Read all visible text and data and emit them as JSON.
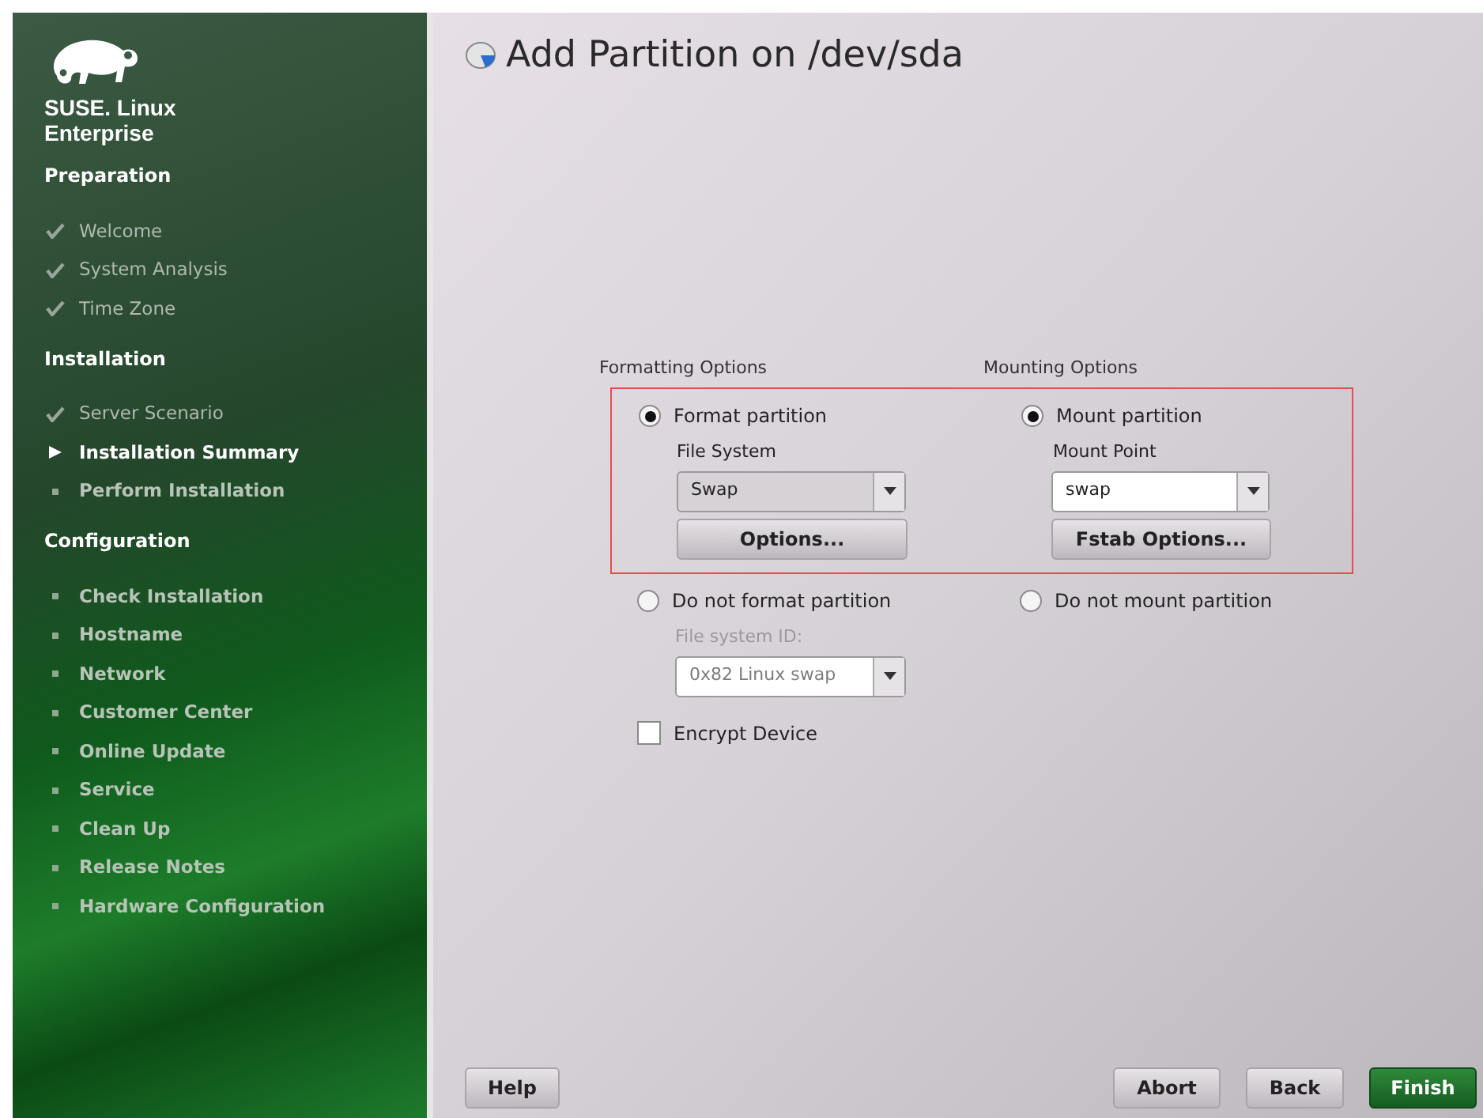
{
  "brand": {
    "line1": "SUSE. Linux",
    "line2": "Enterprise"
  },
  "sidebar": {
    "sections": [
      {
        "title": "Preparation",
        "items": [
          {
            "label": "Welcome",
            "kind": "done"
          },
          {
            "label": "System Analysis",
            "kind": "done"
          },
          {
            "label": "Time Zone",
            "kind": "done"
          }
        ]
      },
      {
        "title": "Installation",
        "items": [
          {
            "label": "Server Scenario",
            "kind": "done"
          },
          {
            "label": "Installation Summary",
            "kind": "current"
          },
          {
            "label": "Perform Installation",
            "kind": "pending"
          }
        ]
      },
      {
        "title": "Configuration",
        "items": [
          {
            "label": "Check Installation",
            "kind": "pending"
          },
          {
            "label": "Hostname",
            "kind": "pending"
          },
          {
            "label": "Network",
            "kind": "pending"
          },
          {
            "label": "Customer Center",
            "kind": "pending"
          },
          {
            "label": "Online Update",
            "kind": "pending"
          },
          {
            "label": "Service",
            "kind": "pending"
          },
          {
            "label": "Clean Up",
            "kind": "pending"
          },
          {
            "label": "Release Notes",
            "kind": "pending"
          },
          {
            "label": "Hardware Configuration",
            "kind": "pending"
          }
        ]
      }
    ]
  },
  "title": "Add Partition on /dev/sda",
  "formatting": {
    "heading": "Formatting Options",
    "format": {
      "label": "Format partition",
      "selected": true
    },
    "file_system": {
      "label": "File System",
      "value": "Swap"
    },
    "options_button": "Options...",
    "no_format": {
      "label": "Do not format partition",
      "selected": false
    },
    "file_system_id": {
      "label": "File system ID:",
      "value": "0x82 Linux swap",
      "disabled": true
    },
    "encrypt": {
      "label": "Encrypt Device",
      "checked": false
    }
  },
  "mounting": {
    "heading": "Mounting Options",
    "mount": {
      "label": "Mount partition",
      "selected": true
    },
    "mount_point": {
      "label": "Mount Point",
      "value": "swap"
    },
    "fstab_button": "Fstab Options...",
    "no_mount": {
      "label": "Do not mount partition",
      "selected": false
    }
  },
  "buttons": {
    "help": "Help",
    "abort": "Abort",
    "back": "Back",
    "finish": "Finish"
  }
}
